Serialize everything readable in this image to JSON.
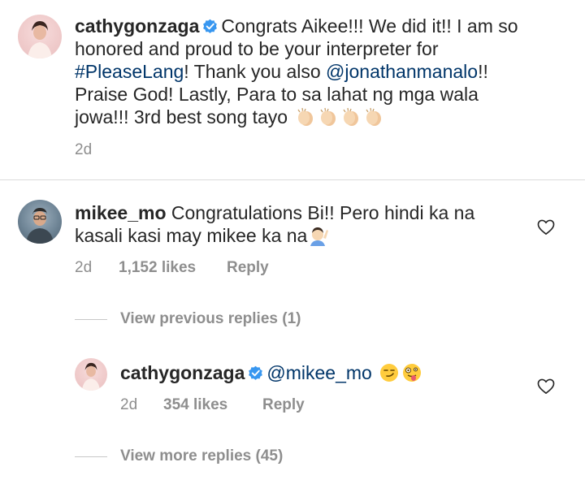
{
  "comment1": {
    "username": "cathygonzaga",
    "text_a": "Congrats Aikee!!! We did it!! I am so",
    "text_b": "honored and proud to be your interpreter for",
    "hashtag": "#PleaseLang",
    "text_c": "! Thank you also ",
    "mention": "@jonathanmanalo",
    "text_d": "!!",
    "text_e": "Praise God! Lastly, Para to sa lahat ng mga wala",
    "text_f": "jowa!!! 3rd best song tayo",
    "emojis": "clapping-hands-x4",
    "time": "2d"
  },
  "comment2": {
    "username": "mikee_mo",
    "text_a": "Congratulations Bi!! Pero hindi ka na",
    "text_b": "kasali kasi may mikee ka na",
    "emoji": "person-raising-hand",
    "time": "2d",
    "likes": "1,152 likes",
    "reply": "Reply"
  },
  "view_previous": "View previous replies (1)",
  "reply1": {
    "username": "cathygonzaga",
    "mention": "@mikee_mo",
    "emojis": "smirk-face, zany-face",
    "time": "2d",
    "likes": "354 likes",
    "reply": "Reply"
  },
  "view_more": "View more replies (45)",
  "colors": {
    "text": "#262626",
    "meta": "#8e8e8e",
    "link": "#003569",
    "verified": "#3897f0",
    "divider": "#dbdbdb"
  }
}
